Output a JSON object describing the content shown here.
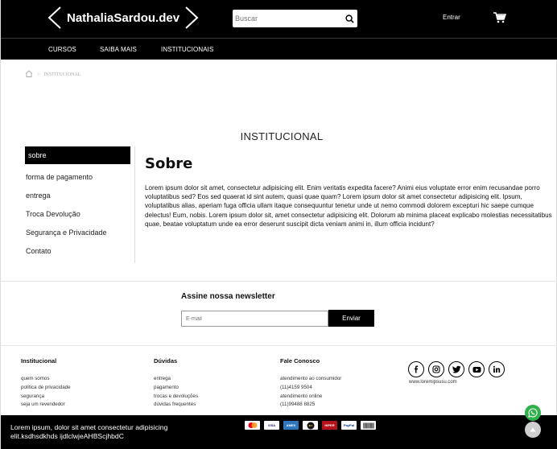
{
  "header": {
    "logo_text": "NathaliaSardou.dev",
    "search_placeholder": "Buscar",
    "login_label": "Entrar",
    "nav": [
      "CURSOS",
      "SAIBA MAIS",
      "INSTITUCIONAIS"
    ]
  },
  "breadcrumb": {
    "separator": ">",
    "current": "INSTITUCIONAL"
  },
  "page_title": "INSTITUCIONAL",
  "sidebar": {
    "items": [
      {
        "label": "sobre",
        "active": true
      },
      {
        "label": "forma de pagamento"
      },
      {
        "label": "entrega"
      },
      {
        "label": "Troca Devolução"
      },
      {
        "label": "Segurança e Privacidade"
      },
      {
        "label": "Contato"
      }
    ]
  },
  "content": {
    "heading": "Sobre",
    "body": "Lorem ipsum dolor sit amet, consectetur adipisicing elit. Enim veritatis expedita facere? Animi eius voluptate error enim recusandae porro voluptatibus sed? Eos sed quaerat id sint autem, quasi quae quam? Lorem ipsum dolor sit amet consectetur adipisicing elit. Ipsum, voluptatibus alias, aperiam fuga officia ullam itaque consequuntur tenetur unde ut nemo commodi dolorem excepturi hic saepe cumque delectus! Eum, nobis. Lorem ipsum dolor sit, amet consectetur adipisicing elit. Dolorum ab minima placeat explicabo molestias necessitatibus quae, beatae voluptatum unde ea error deserunt suscipit dicta veniam animi in, illum officia incidunt?"
  },
  "newsletter": {
    "title": "Assine nossa newsletter",
    "placeholder": "E-mail",
    "button": "Enviar"
  },
  "footer": {
    "institucional": {
      "title": "Institucional",
      "links": [
        "quem somos",
        "política de privacidade",
        "segurança",
        "seja um revendedor"
      ]
    },
    "duvidas": {
      "title": "Dúvidas",
      "links": [
        "entrega",
        "pagamento",
        "trocas e devoluções",
        "dúvidas frequentes"
      ]
    },
    "contato": {
      "title": "Fale Conosco",
      "links": [
        "atendimento ao consumidor",
        "(11)4159 9504",
        "atendimento online",
        "(11)99488 8825"
      ]
    },
    "site_url": "www.loremipsusu.com",
    "social_icons": [
      "facebook-icon",
      "instagram-icon",
      "twitter-icon",
      "youtube-icon",
      "linkedin-icon"
    ],
    "bottom_text": "Lorem ipsum, dolor sit amet consectetur adipisicing elit.ksdhsdkhds ijdlclwjeAHBScjhbdC",
    "payment_icons": [
      "mastercard",
      "VISA",
      "AMEX",
      "ELO",
      "HIPER",
      "PayPal",
      "BOLETO"
    ]
  },
  "colors": {
    "header_bg": "#000000",
    "accent_whatsapp": "#2fb14a"
  }
}
